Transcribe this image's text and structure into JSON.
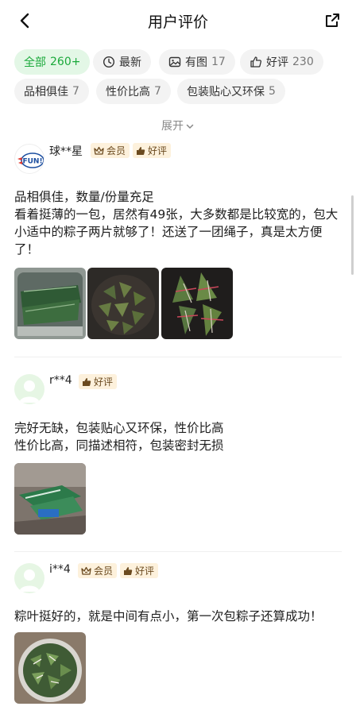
{
  "header": {
    "title": "用户评价"
  },
  "filters": [
    {
      "label": "全部",
      "count": "260+"
    },
    {
      "label": "最新",
      "count": ""
    },
    {
      "label": "有图",
      "count": "17"
    },
    {
      "label": "好评",
      "count": "230"
    },
    {
      "label": "品相俱佳",
      "count": "7"
    },
    {
      "label": "性价比高",
      "count": "7"
    },
    {
      "label": "包装贴心又环保",
      "count": "5"
    }
  ],
  "expand_label": "展开",
  "reviews": [
    {
      "username": "球**星",
      "member_badge": "会员",
      "rating_badge": "好评",
      "lines": [
        "品相俱佳，数量/份量充足",
        "看着挺薄的一包，居然有49张，大多数都是比较宽的，包大小适中的粽子两片就够了！还送了一团绳子，真是太方便了！"
      ]
    },
    {
      "username": "r**4",
      "rating_badge": "好评",
      "lines": [
        "完好无缺，包装贴心又环保，性价比高",
        "性价比高，同描述相符，包装密封无损"
      ]
    },
    {
      "username": "i**4",
      "member_badge": "会员",
      "rating_badge": "好评",
      "lines": [
        "粽叶挺好的，就是中间有点小，第一次包粽子还算成功！"
      ]
    }
  ],
  "colors": {
    "accent_green": "#1aa93a",
    "chip_bg": "#f3f3f3",
    "badge_bg": "#fdf1dc"
  },
  "avatar_logo_text": "FUN!"
}
